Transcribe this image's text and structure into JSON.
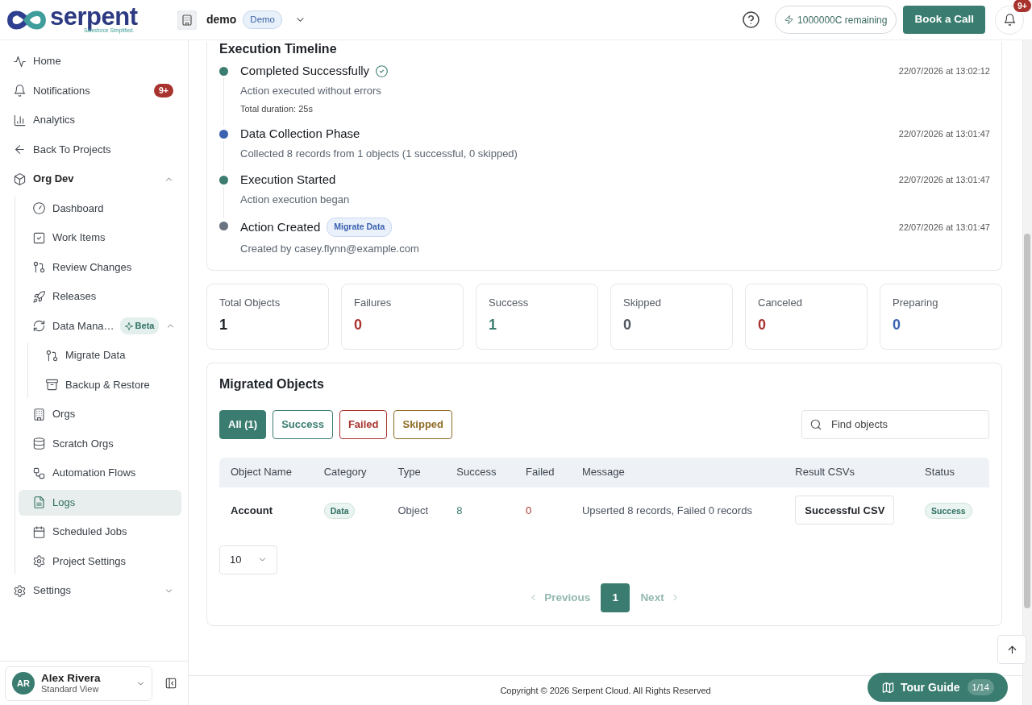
{
  "header": {
    "brand": "serpent",
    "tagline": "Salesforce Simplified.",
    "project": "demo",
    "project_badge": "Demo",
    "credits": "1000000C remaining",
    "book_call": "Book a Call",
    "notification_count": "9+"
  },
  "sidebar": {
    "items": [
      {
        "label": "Home",
        "selected": false
      },
      {
        "label": "Notifications",
        "selected": false,
        "badge": {
          "kind": "count",
          "text": "9+"
        }
      },
      {
        "label": "Analytics",
        "selected": false
      },
      {
        "label": "Back To Projects",
        "selected": false
      },
      {
        "label": "Org Dev",
        "selected": false,
        "expanded": true,
        "children": [
          {
            "label": "Dashboard",
            "selected": false
          },
          {
            "label": "Work Items",
            "selected": false
          },
          {
            "label": "Review Changes",
            "selected": false
          },
          {
            "label": "Releases",
            "selected": false
          },
          {
            "label": "Data Mana…",
            "selected": false,
            "expanded": true,
            "badge": {
              "kind": "beta",
              "text": "Beta"
            },
            "children": [
              {
                "label": "Migrate Data",
                "selected": false
              },
              {
                "label": "Backup & Restore",
                "selected": false
              }
            ]
          },
          {
            "label": "Orgs",
            "selected": false
          },
          {
            "label": "Scratch Orgs",
            "selected": false
          },
          {
            "label": "Automation Flows",
            "selected": false
          },
          {
            "label": "Logs",
            "selected": true
          },
          {
            "label": "Scheduled Jobs",
            "selected": false
          },
          {
            "label": "Project Settings",
            "selected": false
          }
        ]
      },
      {
        "label": "Settings",
        "selected": false,
        "expanded": false
      }
    ]
  },
  "user": {
    "initials": "AR",
    "name": "Alex Rivera",
    "role": "Standard View"
  },
  "timeline": {
    "title": "Execution Timeline",
    "events": [
      {
        "kind": "completed",
        "color": "#3d7d70",
        "title": "Completed Successfully",
        "time": "22/07/2026 at 13:02:12",
        "description": "Action executed without errors",
        "note": "Total duration: 25s"
      },
      {
        "kind": "phase",
        "color": "#3b63b0",
        "title": "Data Collection Phase",
        "time": "22/07/2026 at 13:01:47",
        "description": "Collected 8 records from 1 objects (1 successful, 0 skipped)"
      },
      {
        "kind": "started",
        "color": "#3d7d70",
        "title": "Execution Started",
        "time": "22/07/2026 at 13:01:47",
        "description": "Action execution began"
      },
      {
        "kind": "created",
        "color": "#6b7280",
        "title": "Action Created",
        "badge": "Migrate Data",
        "time": "22/07/2026 at 13:01:47",
        "description": "Created by casey.flynn@example.com"
      }
    ]
  },
  "stats": [
    {
      "label": "Total Objects",
      "value": "1",
      "color": "#1f2328"
    },
    {
      "label": "Failures",
      "value": "0",
      "color": "#a8322d"
    },
    {
      "label": "Success",
      "value": "1",
      "color": "#3d7d70"
    },
    {
      "label": "Skipped",
      "value": "0",
      "color": "#50565e"
    },
    {
      "label": "Canceled",
      "value": "0",
      "color": "#a8322d"
    },
    {
      "label": "Preparing",
      "value": "0",
      "color": "#3b63b0"
    }
  ],
  "migrated_objects": {
    "title": "Migrated Objects",
    "filters": [
      {
        "label": "All (1)",
        "selected": true,
        "color": "#3a7d70"
      },
      {
        "label": "Success",
        "selected": false,
        "color": "#3a7d70"
      },
      {
        "label": "Failed",
        "selected": false,
        "color": "#a8322d"
      },
      {
        "label": "Skipped",
        "selected": false,
        "color": "#8f6b25"
      }
    ],
    "search": {
      "placeholder": "Find objects"
    },
    "table": {
      "columns": [
        "Object Name",
        "Category",
        "Type",
        "Success",
        "Failed",
        "Message",
        "Result CSVs",
        "Status"
      ],
      "rows": [
        {
          "object_name": "Account",
          "category": "Data",
          "type": "Object",
          "success": "8",
          "failed": "0",
          "message": "Upserted 8 records, Failed 0 records",
          "result_csv": "Successful CSV",
          "status": "Success"
        }
      ]
    },
    "page_size": "10",
    "pagination": {
      "previous": {
        "label": "Previous",
        "disabled": true
      },
      "pages": [
        {
          "label": "1",
          "selected": true
        }
      ],
      "next": {
        "label": "Next",
        "disabled": true
      }
    }
  },
  "footer": "Copyright © 2026 Serpent Cloud. All Rights Reserved",
  "tour_guide": {
    "label": "Tour Guide",
    "step": "1/14"
  }
}
